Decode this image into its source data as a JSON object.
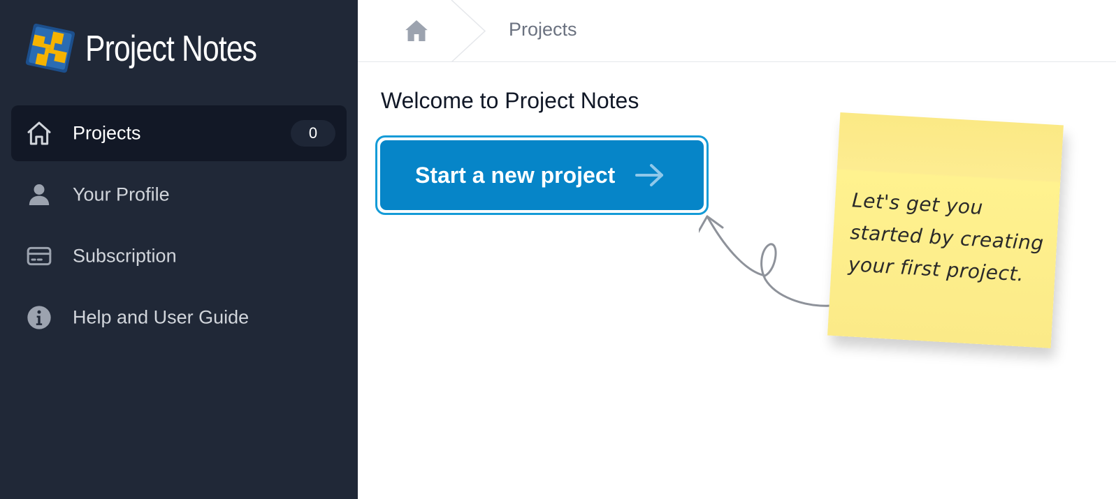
{
  "app": {
    "name": "Project Notes"
  },
  "sidebar": {
    "items": [
      {
        "label": "Projects",
        "icon": "home-icon",
        "badge": "0",
        "active": true
      },
      {
        "label": "Your Profile",
        "icon": "user-icon"
      },
      {
        "label": "Subscription",
        "icon": "credit-card-icon"
      },
      {
        "label": "Help and User Guide",
        "icon": "info-icon"
      }
    ]
  },
  "breadcrumb": {
    "home_icon": "home-icon",
    "current": "Projects"
  },
  "main": {
    "welcome": "Welcome to Project Notes",
    "cta_label": "Start a new project",
    "cta_icon": "arrow-right-icon",
    "sticky_note": "Let's get you started by creating your first project."
  },
  "colors": {
    "sidebar_bg": "#202837",
    "active_item_bg": "#121826",
    "primary": "#0685c8",
    "sticky_note": "#fdec91"
  }
}
